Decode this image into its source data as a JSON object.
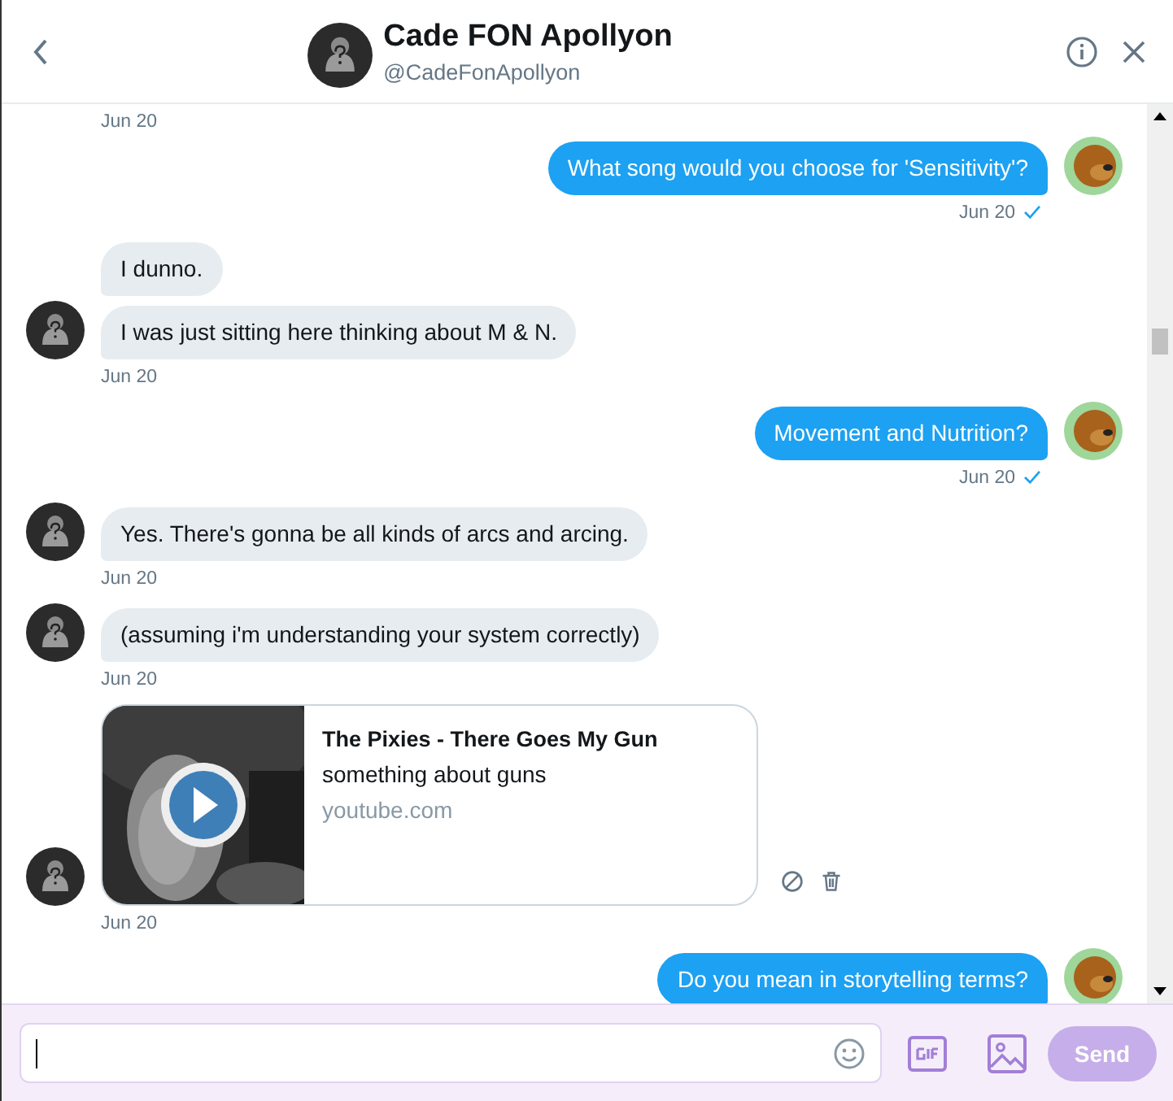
{
  "header": {
    "name": "Cade FON Apollyon",
    "handle": "@CadeFonApollyon"
  },
  "messages": [
    {
      "kind": "stamp",
      "time": "Jun 20"
    },
    {
      "kind": "sent",
      "text": "What song would you choose for 'Sensitivity'?",
      "avatar": true,
      "time": "Jun 20",
      "read": true
    },
    {
      "kind": "received",
      "text": "I dunno.",
      "avatar": false
    },
    {
      "kind": "received",
      "text": "I was just sitting here thinking about M & N.",
      "avatar": true,
      "time": "Jun 20"
    },
    {
      "kind": "sent",
      "text": "Movement and Nutrition?",
      "avatar": true,
      "time": "Jun 20",
      "read": true
    },
    {
      "kind": "received",
      "text": "Yes. There's gonna be all kinds of arcs and arcing.",
      "avatar": true,
      "time": "Jun 20"
    },
    {
      "kind": "received",
      "text": "(assuming i'm understanding your system correctly)",
      "avatar": true,
      "time": "Jun 20"
    },
    {
      "kind": "card",
      "title": "The Pixies - There Goes My Gun",
      "description": "something about guns",
      "domain": "youtube.com",
      "avatar": true,
      "time": "Jun 20"
    },
    {
      "kind": "sent",
      "text": "Do you mean in storytelling terms?",
      "avatar": true,
      "read": false
    }
  ],
  "composer": {
    "send": {
      "label": "Send",
      "disabled": true
    }
  }
}
